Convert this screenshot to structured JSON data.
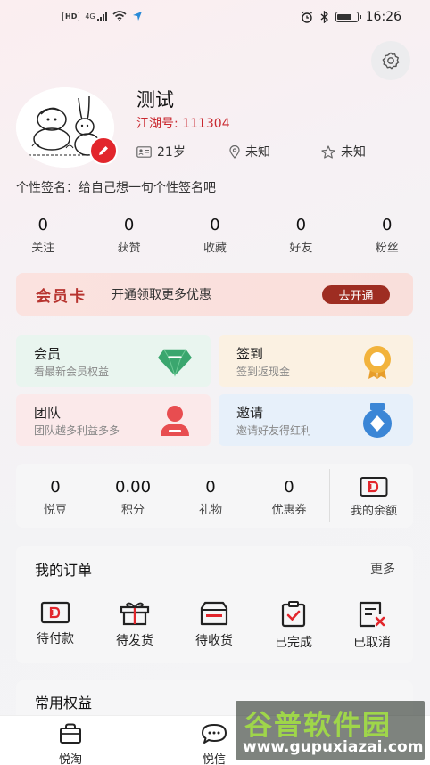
{
  "status_bar": {
    "hd": "HD",
    "network": "4G",
    "time": "16:26"
  },
  "profile": {
    "nickname": "测试",
    "jianghu_id": "江湖号: 111304",
    "age": "21岁",
    "location": "未知",
    "constellation": "未知",
    "signature": "个性签名：给自己想一句个性签名吧"
  },
  "stats": [
    {
      "value": "0",
      "label": "关注"
    },
    {
      "value": "0",
      "label": "获赞"
    },
    {
      "value": "0",
      "label": "收藏"
    },
    {
      "value": "0",
      "label": "好友"
    },
    {
      "value": "0",
      "label": "粉丝"
    }
  ],
  "member_card": {
    "title": "会员卡",
    "desc": "开通领取更多优惠",
    "button": "去开通"
  },
  "features": [
    {
      "title": "会员",
      "subtitle": "看最新会员权益",
      "icon": "diamond-icon",
      "bg": "#e9f5ef"
    },
    {
      "title": "签到",
      "subtitle": "签到返现金",
      "icon": "medal-icon",
      "bg": "#fbf1e2"
    },
    {
      "title": "团队",
      "subtitle": "团队越多利益多多",
      "icon": "person-icon",
      "bg": "#fbe9ea"
    },
    {
      "title": "邀请",
      "subtitle": "邀请好友得红利",
      "icon": "badge-icon",
      "bg": "#e7f0fa"
    }
  ],
  "wallet": {
    "items": [
      {
        "value": "0",
        "label": "悦豆"
      },
      {
        "value": "0.00",
        "label": "积分"
      },
      {
        "value": "0",
        "label": "礼物"
      },
      {
        "value": "0",
        "label": "优惠券"
      }
    ],
    "balance_label": "我的余额"
  },
  "orders": {
    "title": "我的订单",
    "more": "更多",
    "items": [
      {
        "label": "待付款",
        "icon": "wallet-icon"
      },
      {
        "label": "待发货",
        "icon": "gift-box-icon"
      },
      {
        "label": "待收货",
        "icon": "package-icon"
      },
      {
        "label": "已完成",
        "icon": "clipboard-check-icon"
      },
      {
        "label": "已取消",
        "icon": "document-cancel-icon"
      }
    ]
  },
  "benefits": {
    "title": "常用权益"
  },
  "tabbar": [
    {
      "label": "悦淘",
      "icon": "shopping-bag-icon"
    },
    {
      "label": "悦信",
      "icon": "chat-bubble-icon"
    }
  ],
  "watermark": {
    "cn": "谷普软件园",
    "url": "www.gupuxiazai.com"
  },
  "colors": {
    "accent_red": "#e2262c",
    "brand_dark_red": "#9e2d22"
  }
}
